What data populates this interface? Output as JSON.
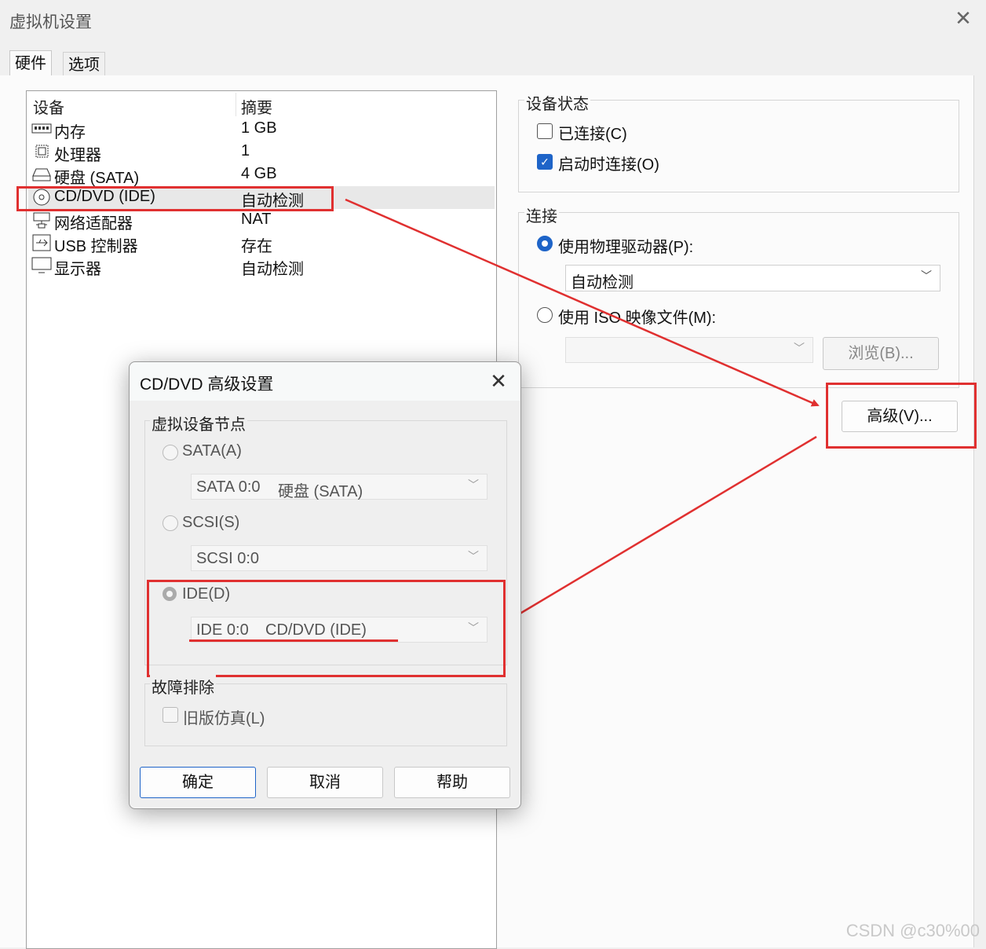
{
  "window": {
    "title": "虚拟机设置",
    "close_glyph": "✕"
  },
  "tabs": [
    {
      "label": "硬件"
    },
    {
      "label": "选项"
    }
  ],
  "device_table": {
    "headers": {
      "device": "设备",
      "summary": "摘要"
    },
    "rows": [
      {
        "name": "内存",
        "summary": "1 GB",
        "icon": "memory-icon"
      },
      {
        "name": "处理器",
        "summary": "1",
        "icon": "processor-icon"
      },
      {
        "name": "硬盘 (SATA)",
        "summary": "4 GB",
        "icon": "hard-disk-icon"
      },
      {
        "name": "CD/DVD (IDE)",
        "summary": "自动检测",
        "icon": "cd-dvd-icon",
        "selected": true
      },
      {
        "name": "网络适配器",
        "summary": "NAT",
        "icon": "network-adapter-icon"
      },
      {
        "name": "USB 控制器",
        "summary": "存在",
        "icon": "usb-controller-icon"
      },
      {
        "name": "显示器",
        "summary": "自动检测",
        "icon": "display-icon"
      }
    ]
  },
  "device_status": {
    "legend": "设备状态",
    "connected": {
      "label": "已连接(C)",
      "checked": false
    },
    "connect_at_power_on": {
      "label": "启动时连接(O)",
      "checked": true
    }
  },
  "connection": {
    "legend": "连接",
    "physical_drive": {
      "label": "使用物理驱动器(P):",
      "selected": true,
      "value": "自动检测"
    },
    "iso_image": {
      "label": "使用 ISO 映像文件(M):",
      "selected": false,
      "value": ""
    },
    "browse_label": "浏览(B)...",
    "advanced_label": "高级(V)..."
  },
  "dialog": {
    "title": "CD/DVD 高级设置",
    "close_glyph": "✕",
    "node_group_legend": "虚拟设备节点",
    "sata": {
      "label": "SATA(A)",
      "value_node": "SATA 0:0",
      "value_device": "硬盘 (SATA)"
    },
    "scsi": {
      "label": "SCSI(S)",
      "value_node": "SCSI 0:0"
    },
    "ide": {
      "label": "IDE(D)",
      "value_node": "IDE 0:0",
      "value_device": "CD/DVD (IDE)",
      "selected": true
    },
    "troubleshoot_legend": "故障排除",
    "legacy_emulation": {
      "label": "旧版仿真(L)",
      "checked": false
    },
    "buttons": {
      "ok": "确定",
      "cancel": "取消",
      "help": "帮助"
    }
  },
  "watermark": "CSDN @c30%00",
  "accent_color": "#1e64c8",
  "annotation_color": "#e03030"
}
